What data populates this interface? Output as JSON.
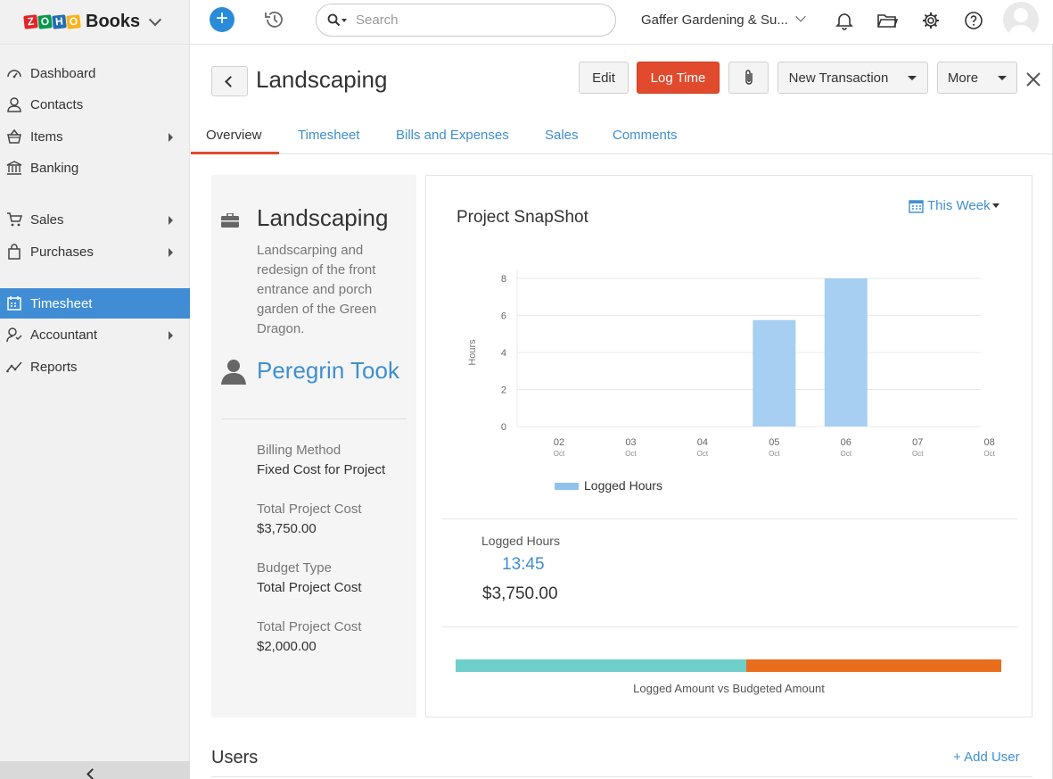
{
  "brand": {
    "zoho_letters": [
      "Z",
      "O",
      "H",
      "O"
    ],
    "zoho_colors": [
      "#e42527",
      "#089949",
      "#226db4",
      "#f9b21d"
    ],
    "product": "Books"
  },
  "sidebar": {
    "items": [
      {
        "label": "Dashboard",
        "icon": "dashboard-icon",
        "has_arrow": false
      },
      {
        "label": "Contacts",
        "icon": "contacts-icon",
        "has_arrow": false
      },
      {
        "label": "Items",
        "icon": "items-icon",
        "has_arrow": true
      },
      {
        "label": "Banking",
        "icon": "banking-icon",
        "has_arrow": false
      },
      {
        "label": "Sales",
        "icon": "sales-icon",
        "has_arrow": true
      },
      {
        "label": "Purchases",
        "icon": "purchases-icon",
        "has_arrow": true
      },
      {
        "label": "Timesheet",
        "icon": "timesheet-icon",
        "has_arrow": false,
        "active": true
      },
      {
        "label": "Accountant",
        "icon": "accountant-icon",
        "has_arrow": true
      },
      {
        "label": "Reports",
        "icon": "reports-icon",
        "has_arrow": false
      }
    ]
  },
  "topbar": {
    "search_placeholder": "Search",
    "organization": "Gaffer Gardening & Su..."
  },
  "header": {
    "title": "Landscaping",
    "edit_label": "Edit",
    "log_time_label": "Log Time",
    "new_transaction_label": "New Transaction",
    "more_label": "More"
  },
  "tabs": [
    {
      "label": "Overview",
      "active": true
    },
    {
      "label": "Timesheet"
    },
    {
      "label": "Bills and Expenses"
    },
    {
      "label": "Sales"
    },
    {
      "label": "Comments"
    }
  ],
  "project": {
    "name": "Landscaping",
    "description": "Landscarping and redesign of the front entrance and porch garden of the Green Dragon.",
    "customer": "Peregrin Took",
    "fields": [
      {
        "label": "Billing Method",
        "value": "Fixed Cost for Project"
      },
      {
        "label": "Total Project Cost",
        "value": "$3,750.00"
      },
      {
        "label": "Budget Type",
        "value": "Total Project Cost"
      },
      {
        "label": "Total Project Cost",
        "value": "$2,000.00"
      }
    ]
  },
  "snapshot": {
    "title": "Project SnapShot",
    "period": "This Week",
    "logged_hours_label": "Logged Hours",
    "logged_hours_value": "13:45",
    "logged_amount": "$3,750.00",
    "progress_label": "Logged Amount vs Budgeted Amount",
    "logged_fraction": 0.533,
    "colors": {
      "logged": "#6fcfcb",
      "budget": "#e86e1e",
      "bar": "#a6cff2",
      "legend": "#8fc3ec"
    }
  },
  "chart_data": {
    "type": "bar",
    "categories": [
      "02",
      "03",
      "04",
      "05",
      "06",
      "07",
      "08"
    ],
    "sub_labels": [
      "Oct",
      "Oct",
      "Oct",
      "Oct",
      "Oct",
      "Oct",
      "Oct"
    ],
    "series": [
      {
        "name": "Logged Hours",
        "values": [
          0,
          0,
          0,
          5.75,
          8,
          0,
          0
        ]
      }
    ],
    "ylabel": "Hours",
    "ylim": [
      0,
      8
    ],
    "yticks": [
      0,
      2,
      4,
      6,
      8
    ],
    "grid": true,
    "legend": "bottom-left"
  },
  "users": {
    "title": "Users",
    "add_label": "+ Add User"
  }
}
